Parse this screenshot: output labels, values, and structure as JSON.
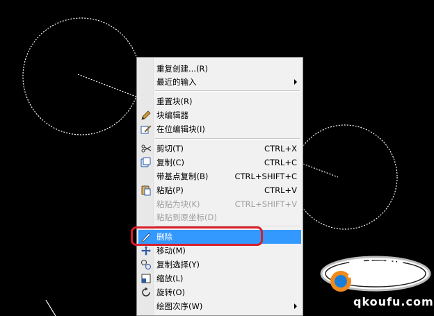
{
  "menu": {
    "items": [
      {
        "label": "重复创建...(R)",
        "shortcut": "",
        "icon": "",
        "submenu": false,
        "disabled": false,
        "highlight": false
      },
      {
        "label": "最近的输入",
        "shortcut": "",
        "icon": "",
        "submenu": true,
        "disabled": false,
        "highlight": false
      },
      {
        "label": "重置块(R)",
        "shortcut": "",
        "icon": "",
        "submenu": false,
        "disabled": false,
        "highlight": false
      },
      {
        "label": "块编辑器",
        "shortcut": "",
        "icon": "block-editor-icon",
        "submenu": false,
        "disabled": false,
        "highlight": false
      },
      {
        "label": "在位编辑块(I)",
        "shortcut": "",
        "icon": "edit-in-place-icon",
        "submenu": false,
        "disabled": false,
        "highlight": false
      },
      {
        "label": "剪切(T)",
        "shortcut": "CTRL+X",
        "icon": "scissors-icon",
        "submenu": false,
        "disabled": false,
        "highlight": false
      },
      {
        "label": "复制(C)",
        "shortcut": "CTRL+C",
        "icon": "copy-icon",
        "submenu": false,
        "disabled": false,
        "highlight": false
      },
      {
        "label": "带基点复制(B)",
        "shortcut": "CTRL+SHIFT+C",
        "icon": "",
        "submenu": false,
        "disabled": false,
        "highlight": false
      },
      {
        "label": "粘贴(P)",
        "shortcut": "CTRL+V",
        "icon": "paste-icon",
        "submenu": false,
        "disabled": false,
        "highlight": false
      },
      {
        "label": "粘贴为块(K)",
        "shortcut": "CTRL+SHIFT+V",
        "icon": "",
        "submenu": false,
        "disabled": true,
        "highlight": false
      },
      {
        "label": "粘贴到原坐标(D)",
        "shortcut": "",
        "icon": "",
        "submenu": false,
        "disabled": true,
        "highlight": false
      },
      {
        "label": "删除",
        "shortcut": "",
        "icon": "eraser-icon",
        "submenu": false,
        "disabled": false,
        "highlight": true
      },
      {
        "label": "移动(M)",
        "shortcut": "",
        "icon": "move-icon",
        "submenu": false,
        "disabled": false,
        "highlight": false
      },
      {
        "label": "复制选择(Y)",
        "shortcut": "",
        "icon": "copy-select-icon",
        "submenu": false,
        "disabled": false,
        "highlight": false
      },
      {
        "label": "缩放(L)",
        "shortcut": "",
        "icon": "scale-icon",
        "submenu": false,
        "disabled": false,
        "highlight": false
      },
      {
        "label": "旋转(O)",
        "shortcut": "",
        "icon": "rotate-icon",
        "submenu": false,
        "disabled": false,
        "highlight": false
      },
      {
        "label": "绘图次序(W)",
        "shortcut": "",
        "icon": "",
        "submenu": true,
        "disabled": false,
        "highlight": false
      }
    ]
  },
  "watermark": {
    "line1": "爱抠脚",
    "line2": "qkoufu.com"
  },
  "colors": {
    "background": "#000000",
    "highlight": "#3399ff",
    "annotation": "#d81e2a"
  }
}
